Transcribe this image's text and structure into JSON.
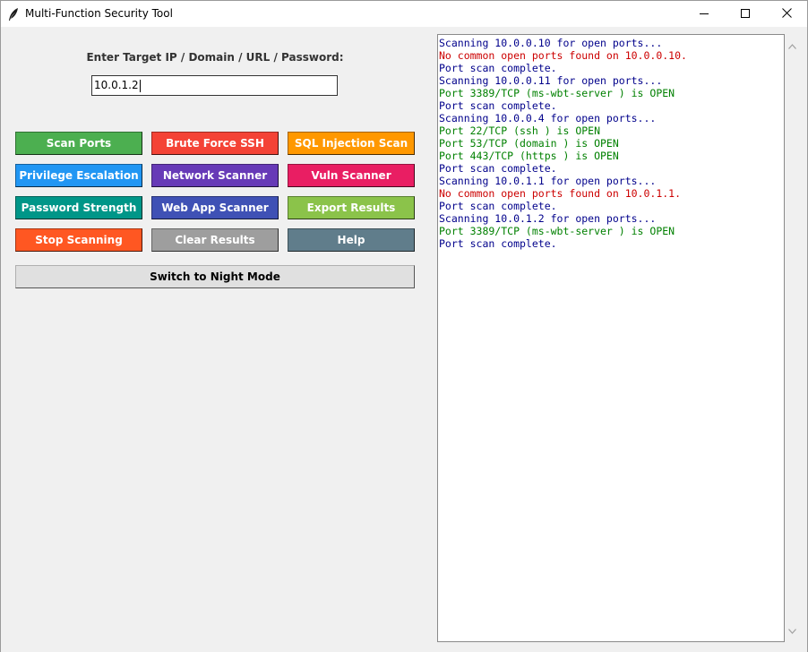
{
  "window": {
    "title": "Multi-Function Security Tool"
  },
  "form": {
    "prompt": "Enter Target IP / Domain / URL / Password:",
    "target_value": "10.0.1.2"
  },
  "buttons": [
    {
      "id": "scan-ports-button",
      "label": "Scan Ports",
      "color": "#4caf50",
      "col": 1,
      "row": 1
    },
    {
      "id": "brute-force-ssh-button",
      "label": "Brute Force SSH",
      "color": "#f44336",
      "col": 2,
      "row": 1
    },
    {
      "id": "sql-injection-scan-button",
      "label": "SQL Injection Scan",
      "color": "#ff9800",
      "col": 3,
      "row": 1
    },
    {
      "id": "privilege-escalation-button",
      "label": "Privilege Escalation",
      "color": "#2196f3",
      "col": 1,
      "row": 2
    },
    {
      "id": "network-scanner-button",
      "label": "Network Scanner",
      "color": "#673ab7",
      "col": 2,
      "row": 2
    },
    {
      "id": "vuln-scanner-button",
      "label": "Vuln Scanner",
      "color": "#e91e63",
      "col": 3,
      "row": 2
    },
    {
      "id": "password-strength-button",
      "label": "Password Strength",
      "color": "#009688",
      "col": 1,
      "row": 3
    },
    {
      "id": "web-app-scanner-button",
      "label": "Web App Scanner",
      "color": "#3f51b5",
      "col": 2,
      "row": 3
    },
    {
      "id": "export-results-button",
      "label": "Export Results",
      "color": "#8bc34a",
      "col": 3,
      "row": 3
    },
    {
      "id": "stop-scanning-button",
      "label": "Stop Scanning",
      "color": "#ff5722",
      "col": 1,
      "row": 4
    },
    {
      "id": "clear-results-button",
      "label": "Clear Results",
      "color": "#9e9e9e",
      "col": 2,
      "row": 4
    },
    {
      "id": "help-button",
      "label": "Help",
      "color": "#607d8b",
      "col": 3,
      "row": 4
    }
  ],
  "night_mode": {
    "label": "Switch to Night Mode"
  },
  "output": {
    "lines": [
      {
        "text": "Scanning 10.0.0.10 for open ports...",
        "kind": "info"
      },
      {
        "text": "No common open ports found on 10.0.0.10.",
        "kind": "error"
      },
      {
        "text": "Port scan complete.",
        "kind": "info"
      },
      {
        "text": "Scanning 10.0.0.11 for open ports...",
        "kind": "info"
      },
      {
        "text": "Port 3389/TCP (ms-wbt-server ) is OPEN",
        "kind": "open"
      },
      {
        "text": "Port scan complete.",
        "kind": "info"
      },
      {
        "text": "Scanning 10.0.0.4 for open ports...",
        "kind": "info"
      },
      {
        "text": "Port 22/TCP (ssh ) is OPEN",
        "kind": "open"
      },
      {
        "text": "Port 53/TCP (domain ) is OPEN",
        "kind": "open"
      },
      {
        "text": "Port 443/TCP (https ) is OPEN",
        "kind": "open"
      },
      {
        "text": "Port scan complete.",
        "kind": "info"
      },
      {
        "text": "Scanning 10.0.1.1 for open ports...",
        "kind": "info"
      },
      {
        "text": "No common open ports found on 10.0.1.1.",
        "kind": "error"
      },
      {
        "text": "Port scan complete.",
        "kind": "info"
      },
      {
        "text": "Scanning 10.0.1.2 for open ports...",
        "kind": "info"
      },
      {
        "text": "Port 3389/TCP (ms-wbt-server ) is OPEN",
        "kind": "open"
      },
      {
        "text": "Port scan complete.",
        "kind": "info"
      }
    ],
    "colors": {
      "info": "#00008b",
      "error": "#cc0000",
      "open": "#008000"
    }
  },
  "icons": {
    "app": "feather-icon",
    "minimize": "minimize-icon",
    "maximize": "maximize-icon",
    "close": "close-icon",
    "scroll_up": "chevron-up-icon",
    "scroll_down": "chevron-down-icon"
  }
}
